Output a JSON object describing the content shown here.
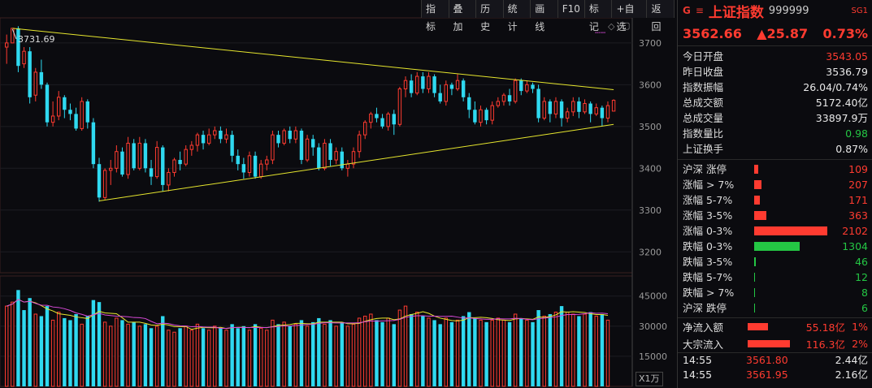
{
  "toolbar": {
    "items": [
      "指标",
      "叠加",
      "历史",
      "统计",
      "画线",
      "F10",
      "标记",
      "+自选",
      "返回"
    ]
  },
  "chart": {
    "price_axis": [
      "3700",
      "3600",
      "3500",
      "3400",
      "3300",
      "3200"
    ],
    "volume_axis": [
      "45000",
      "30000",
      "15000"
    ],
    "volume_unit": "X1万",
    "peak_label": "3731.69",
    "colors": {
      "up": "#ff3b30",
      "down": "#2fd9f0",
      "trend": "#e6e62e",
      "ma5": "#e6e62e",
      "ma10": "#d94ad9"
    }
  },
  "chart_data": {
    "type": "candlestick",
    "price_range": [
      3150,
      3760
    ],
    "volume_range": [
      0,
      55000
    ],
    "candles": [
      [
        3690,
        3700,
        3650,
        3720
      ],
      [
        3700,
        3735,
        3700,
        3731.69
      ],
      [
        3735,
        3645,
        3630,
        3740
      ],
      [
        3650,
        3680,
        3640,
        3690
      ],
      [
        3680,
        3570,
        3555,
        3690
      ],
      [
        3575,
        3630,
        3560,
        3640
      ],
      [
        3630,
        3600,
        3590,
        3660
      ],
      [
        3600,
        3510,
        3500,
        3605
      ],
      [
        3510,
        3525,
        3500,
        3560
      ],
      [
        3525,
        3570,
        3515,
        3585
      ],
      [
        3570,
        3540,
        3520,
        3575
      ],
      [
        3540,
        3530,
        3515,
        3555
      ],
      [
        3530,
        3495,
        3490,
        3545
      ],
      [
        3495,
        3560,
        3490,
        3570
      ],
      [
        3560,
        3510,
        3495,
        3565
      ],
      [
        3510,
        3410,
        3400,
        3520
      ],
      [
        3410,
        3330,
        3320,
        3425
      ],
      [
        3330,
        3395,
        3325,
        3400
      ],
      [
        3395,
        3400,
        3360,
        3420
      ],
      [
        3400,
        3440,
        3390,
        3455
      ],
      [
        3440,
        3385,
        3380,
        3450
      ],
      [
        3385,
        3460,
        3375,
        3475
      ],
      [
        3460,
        3400,
        3395,
        3470
      ],
      [
        3400,
        3460,
        3395,
        3475
      ],
      [
        3460,
        3400,
        3390,
        3470
      ],
      [
        3400,
        3380,
        3360,
        3420
      ],
      [
        3380,
        3450,
        3375,
        3465
      ],
      [
        3450,
        3360,
        3345,
        3455
      ],
      [
        3360,
        3390,
        3345,
        3400
      ],
      [
        3390,
        3420,
        3380,
        3425
      ],
      [
        3420,
        3410,
        3395,
        3440
      ],
      [
        3410,
        3445,
        3405,
        3455
      ],
      [
        3445,
        3455,
        3430,
        3465
      ],
      [
        3455,
        3480,
        3440,
        3485
      ],
      [
        3480,
        3460,
        3445,
        3490
      ],
      [
        3460,
        3480,
        3455,
        3495
      ],
      [
        3480,
        3490,
        3470,
        3500
      ],
      [
        3490,
        3470,
        3460,
        3500
      ],
      [
        3470,
        3480,
        3460,
        3495
      ],
      [
        3480,
        3430,
        3415,
        3490
      ],
      [
        3430,
        3410,
        3395,
        3445
      ],
      [
        3410,
        3390,
        3375,
        3425
      ],
      [
        3390,
        3430,
        3380,
        3440
      ],
      [
        3430,
        3380,
        3375,
        3440
      ],
      [
        3380,
        3410,
        3375,
        3420
      ],
      [
        3410,
        3420,
        3395,
        3430
      ],
      [
        3420,
        3480,
        3410,
        3490
      ],
      [
        3480,
        3460,
        3450,
        3490
      ],
      [
        3460,
        3490,
        3455,
        3495
      ],
      [
        3490,
        3470,
        3460,
        3500
      ],
      [
        3470,
        3490,
        3460,
        3500
      ],
      [
        3490,
        3420,
        3410,
        3495
      ],
      [
        3420,
        3470,
        3415,
        3480
      ],
      [
        3470,
        3450,
        3430,
        3480
      ],
      [
        3450,
        3400,
        3395,
        3460
      ],
      [
        3400,
        3460,
        3395,
        3470
      ],
      [
        3460,
        3420,
        3405,
        3470
      ],
      [
        3420,
        3440,
        3410,
        3450
      ],
      [
        3440,
        3400,
        3395,
        3450
      ],
      [
        3400,
        3410,
        3380,
        3420
      ],
      [
        3410,
        3440,
        3400,
        3450
      ],
      [
        3440,
        3480,
        3425,
        3490
      ],
      [
        3480,
        3510,
        3470,
        3515
      ],
      [
        3510,
        3530,
        3495,
        3535
      ],
      [
        3530,
        3520,
        3510,
        3545
      ],
      [
        3520,
        3500,
        3495,
        3530
      ],
      [
        3500,
        3530,
        3490,
        3535
      ],
      [
        3530,
        3505,
        3480,
        3540
      ],
      [
        3505,
        3590,
        3500,
        3595
      ],
      [
        3590,
        3610,
        3570,
        3620
      ],
      [
        3610,
        3580,
        3570,
        3625
      ],
      [
        3580,
        3620,
        3575,
        3630
      ],
      [
        3620,
        3590,
        3580,
        3630
      ],
      [
        3590,
        3620,
        3580,
        3630
      ],
      [
        3620,
        3580,
        3570,
        3625
      ],
      [
        3580,
        3560,
        3555,
        3600
      ],
      [
        3560,
        3600,
        3550,
        3610
      ],
      [
        3600,
        3590,
        3575,
        3605
      ],
      [
        3590,
        3610,
        3585,
        3625
      ],
      [
        3610,
        3570,
        3560,
        3615
      ],
      [
        3570,
        3540,
        3520,
        3580
      ],
      [
        3540,
        3510,
        3505,
        3560
      ],
      [
        3510,
        3540,
        3500,
        3550
      ],
      [
        3540,
        3515,
        3505,
        3545
      ],
      [
        3515,
        3550,
        3505,
        3560
      ],
      [
        3550,
        3560,
        3545,
        3570
      ],
      [
        3560,
        3575,
        3550,
        3580
      ],
      [
        3575,
        3560,
        3550,
        3590
      ],
      [
        3560,
        3610,
        3555,
        3615
      ],
      [
        3610,
        3585,
        3575,
        3615
      ],
      [
        3585,
        3600,
        3580,
        3610
      ],
      [
        3600,
        3590,
        3580,
        3605
      ],
      [
        3590,
        3520,
        3510,
        3600
      ],
      [
        3520,
        3560,
        3515,
        3570
      ],
      [
        3560,
        3530,
        3510,
        3565
      ],
      [
        3530,
        3560,
        3520,
        3570
      ],
      [
        3560,
        3520,
        3500,
        3565
      ],
      [
        3520,
        3535,
        3510,
        3545
      ],
      [
        3535,
        3560,
        3525,
        3570
      ],
      [
        3560,
        3535,
        3520,
        3570
      ],
      [
        3535,
        3555,
        3530,
        3565
      ],
      [
        3555,
        3530,
        3510,
        3560
      ],
      [
        3530,
        3545,
        3525,
        3555
      ],
      [
        3545,
        3520,
        3500,
        3550
      ],
      [
        3520,
        3550,
        3510,
        3560
      ],
      [
        3536.79,
        3562.66,
        3543.05,
        3565
      ]
    ],
    "volumes": [
      [
        40000,
        1
      ],
      [
        42000,
        1
      ],
      [
        48000,
        0
      ],
      [
        38000,
        0
      ],
      [
        44000,
        0
      ],
      [
        36000,
        1
      ],
      [
        35000,
        0
      ],
      [
        40000,
        0
      ],
      [
        33000,
        1
      ],
      [
        37000,
        1
      ],
      [
        34000,
        0
      ],
      [
        33000,
        0
      ],
      [
        36000,
        0
      ],
      [
        31000,
        1
      ],
      [
        35000,
        0
      ],
      [
        43000,
        0
      ],
      [
        42000,
        0
      ],
      [
        32000,
        1
      ],
      [
        30000,
        1
      ],
      [
        34000,
        1
      ],
      [
        33000,
        0
      ],
      [
        31000,
        1
      ],
      [
        32000,
        0
      ],
      [
        30000,
        1
      ],
      [
        31000,
        0
      ],
      [
        29000,
        0
      ],
      [
        30000,
        1
      ],
      [
        35000,
        0
      ],
      [
        28000,
        1
      ],
      [
        27000,
        1
      ],
      [
        29000,
        0
      ],
      [
        30000,
        1
      ],
      [
        28000,
        1
      ],
      [
        31000,
        1
      ],
      [
        29000,
        0
      ],
      [
        28000,
        1
      ],
      [
        30000,
        1
      ],
      [
        29000,
        0
      ],
      [
        28000,
        1
      ],
      [
        31000,
        0
      ],
      [
        29000,
        0
      ],
      [
        30000,
        0
      ],
      [
        28000,
        1
      ],
      [
        31000,
        0
      ],
      [
        29000,
        1
      ],
      [
        28000,
        1
      ],
      [
        33000,
        1
      ],
      [
        31000,
        0
      ],
      [
        32000,
        1
      ],
      [
        30000,
        0
      ],
      [
        31000,
        1
      ],
      [
        33000,
        0
      ],
      [
        30000,
        1
      ],
      [
        32000,
        0
      ],
      [
        34000,
        0
      ],
      [
        31000,
        1
      ],
      [
        33000,
        0
      ],
      [
        30000,
        1
      ],
      [
        32000,
        0
      ],
      [
        30000,
        1
      ],
      [
        31000,
        1
      ],
      [
        34000,
        1
      ],
      [
        35000,
        1
      ],
      [
        36000,
        1
      ],
      [
        33000,
        0
      ],
      [
        32000,
        0
      ],
      [
        34000,
        1
      ],
      [
        31000,
        0
      ],
      [
        38000,
        1
      ],
      [
        40000,
        1
      ],
      [
        36000,
        0
      ],
      [
        37000,
        1
      ],
      [
        35000,
        0
      ],
      [
        34000,
        1
      ],
      [
        33000,
        0
      ],
      [
        31000,
        0
      ],
      [
        34000,
        1
      ],
      [
        32000,
        0
      ],
      [
        33000,
        1
      ],
      [
        35000,
        0
      ],
      [
        37000,
        0
      ],
      [
        34000,
        0
      ],
      [
        33000,
        1
      ],
      [
        32000,
        0
      ],
      [
        33000,
        1
      ],
      [
        34000,
        1
      ],
      [
        33000,
        1
      ],
      [
        32000,
        0
      ],
      [
        36000,
        1
      ],
      [
        34000,
        0
      ],
      [
        33000,
        1
      ],
      [
        32000,
        0
      ],
      [
        38000,
        0
      ],
      [
        35000,
        1
      ],
      [
        36000,
        0
      ],
      [
        37000,
        1
      ],
      [
        40000,
        0
      ],
      [
        37000,
        1
      ],
      [
        36000,
        1
      ],
      [
        35000,
        0
      ],
      [
        36000,
        1
      ],
      [
        37000,
        0
      ],
      [
        35000,
        1
      ],
      [
        36000,
        0
      ],
      [
        33000,
        1
      ]
    ]
  },
  "panel": {
    "marker": "G",
    "menu_icon": "menu-icon",
    "name": "上证指数",
    "code": "999999",
    "badge": "SG1",
    "price": "3562.66",
    "change": "▲25.87",
    "change_pct": "0.73%",
    "stats": [
      {
        "label": "今日开盘",
        "value": "3543.05",
        "color": "red"
      },
      {
        "label": "昨日收盘",
        "value": "3536.79",
        "color": "white"
      },
      {
        "label": "指数振幅",
        "value": "26.04/0.74%",
        "color": "white"
      },
      {
        "label": "总成交额",
        "value": "5172.40亿",
        "color": "white"
      },
      {
        "label": "总成交量",
        "value": "33897.9万",
        "color": "white"
      },
      {
        "label": "指数量比",
        "value": "0.98",
        "color": "green"
      },
      {
        "label": "上证换手",
        "value": "0.87%",
        "color": "white"
      }
    ],
    "breadth": [
      {
        "label": "沪深 涨停",
        "value": "109",
        "color": "#ff3b30",
        "frac": 0.05
      },
      {
        "label": "涨幅 > 7%",
        "value": "207",
        "color": "#ff3b30",
        "frac": 0.1
      },
      {
        "label": "涨幅 5-7%",
        "value": "171",
        "color": "#ff3b30",
        "frac": 0.08
      },
      {
        "label": "涨幅 3-5%",
        "value": "363",
        "color": "#ff3b30",
        "frac": 0.17
      },
      {
        "label": "涨幅 0-3%",
        "value": "2102",
        "color": "#ff3b30",
        "frac": 1.0
      },
      {
        "label": "跌幅 0-3%",
        "value": "1304",
        "color": "#24c644",
        "frac": 0.62
      },
      {
        "label": "跌幅 3-5%",
        "value": "46",
        "color": "#24c644",
        "frac": 0.02
      },
      {
        "label": "跌幅 5-7%",
        "value": "12",
        "color": "#24c644",
        "frac": 0.01
      },
      {
        "label": "跌幅 > 7%",
        "value": "8",
        "color": "#24c644",
        "frac": 0.01
      },
      {
        "label": "沪深 跌停",
        "value": "6",
        "color": "#24c644",
        "frac": 0.01
      }
    ],
    "flows": [
      {
        "label": "净流入额",
        "amount": "55.18亿",
        "pct": "1%",
        "frac": 0.45
      },
      {
        "label": "大宗流入",
        "amount": "116.3亿",
        "pct": "2%",
        "frac": 0.95
      }
    ],
    "ticks": [
      {
        "time": "14:55",
        "price": "3561.80",
        "volume": "2.44亿"
      },
      {
        "time": "14:55",
        "price": "3561.95",
        "volume": "2.16亿"
      }
    ]
  }
}
